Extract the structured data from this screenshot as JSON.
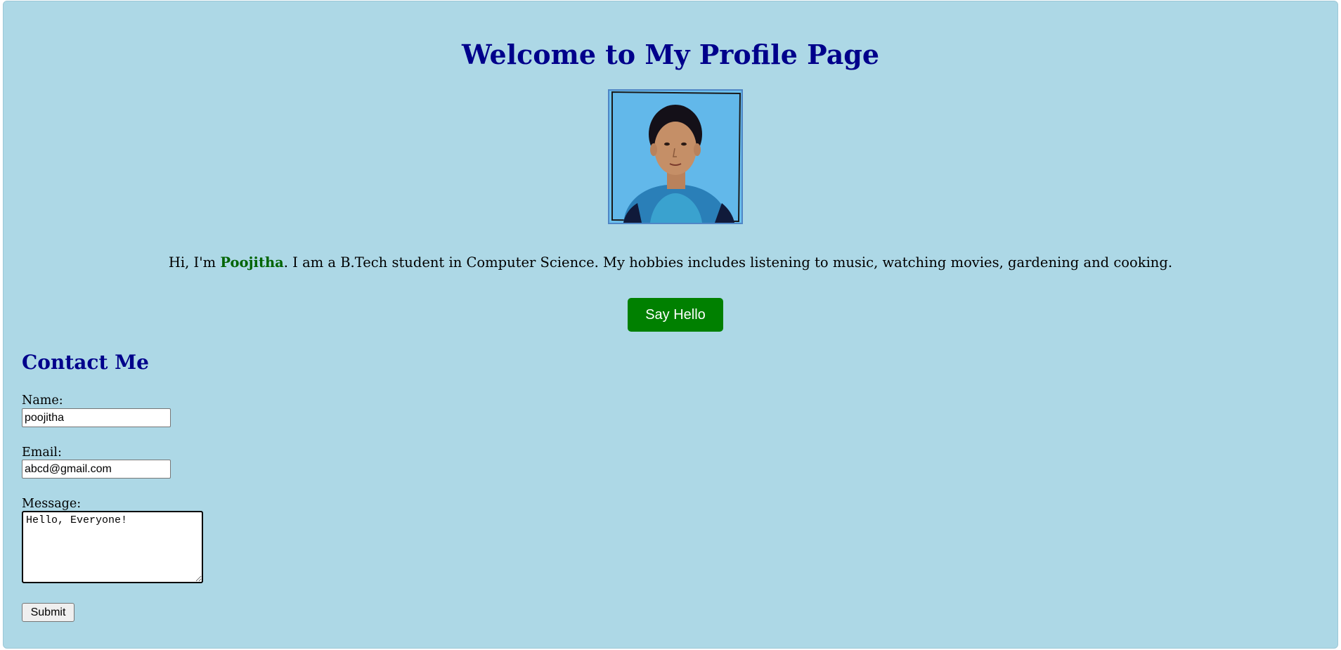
{
  "header": {
    "title": "Welcome to My Profile Page"
  },
  "profile": {
    "photo_alt": "profile-photo",
    "intro_before": "Hi, I'm ",
    "name": "Poojitha",
    "intro_after": ". I am a B.Tech student in Computer Science. My hobbies includes listening to music, watching movies, gardening and cooking."
  },
  "actions": {
    "say_hello_label": "Say Hello"
  },
  "contact": {
    "heading": "Contact Me",
    "name_label": "Name:",
    "name_value": "poojitha",
    "email_label": "Email:",
    "email_value": "abcd@gmail.com",
    "message_label": "Message:",
    "message_value": "Hello, Everyone!",
    "submit_label": "Submit"
  },
  "colors": {
    "page_background": "#add8e6",
    "heading": "#00008b",
    "name_highlight": "#006400",
    "button_green": "#008000"
  }
}
